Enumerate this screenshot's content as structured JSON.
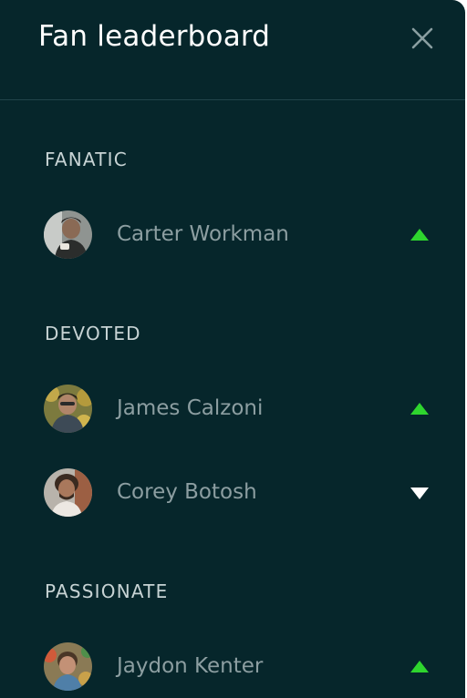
{
  "header": {
    "title": "Fan leaderboard"
  },
  "sections": [
    {
      "heading": "FANATIC",
      "fans": [
        {
          "name": "Carter Workman",
          "trend": "up"
        }
      ]
    },
    {
      "heading": "DEVOTED",
      "fans": [
        {
          "name": "James Calzoni",
          "trend": "up"
        },
        {
          "name": "Corey Botosh",
          "trend": "down"
        }
      ]
    },
    {
      "heading": "PASSIONATE",
      "fans": [
        {
          "name": "Jaydon Kenter",
          "trend": "up"
        }
      ]
    }
  ],
  "icons": {
    "close": "close-icon",
    "trend_up": "triangle-up-icon",
    "trend_down": "triangle-down-icon"
  },
  "colors": {
    "background": "#06262b",
    "trend_up": "#2ed52e",
    "trend_down": "#ffffff",
    "name_text": "#8c9ea1",
    "heading_text": "#c7d3d4"
  }
}
